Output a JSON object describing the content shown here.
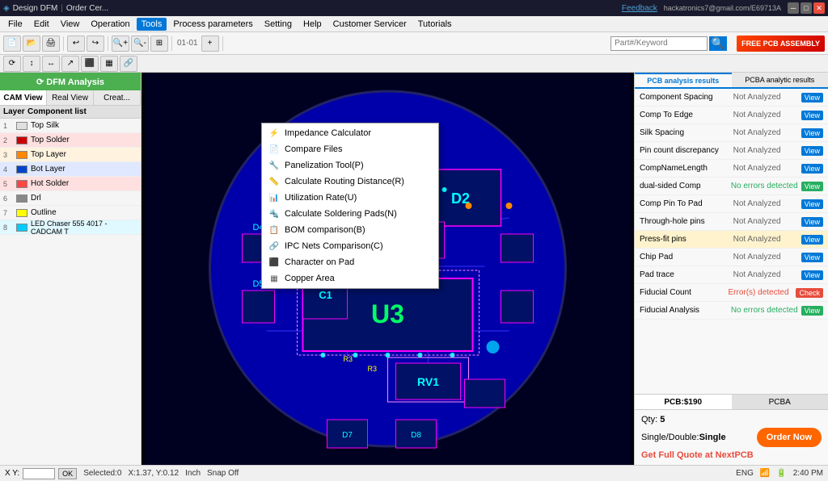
{
  "titlebar": {
    "title1": "Design DFM",
    "title2": "Order Cer...",
    "feedback": "Feedback",
    "user": "hackatronics7@gmail.com/E69713A",
    "controls": [
      "—",
      "□",
      "×"
    ]
  },
  "menubar": {
    "items": [
      "File",
      "Edit",
      "View",
      "Operation",
      "Tools",
      "Process parameters",
      "Setting",
      "Help",
      "Customer Servicer",
      "Tutorials"
    ]
  },
  "toolbar": {
    "part_placeholder": "Part#/Keyword",
    "pcb_assembly": "FREE  PCB ASSEMBLY"
  },
  "dfm": {
    "btn_label": "⟳ DFM Analysis"
  },
  "view_tabs": [
    "CAM View",
    "Real View",
    "Creat..."
  ],
  "layer_header": {
    "layer_col": "Layer",
    "component_col": "Component list"
  },
  "layers": [
    {
      "num": "1",
      "color": "#e0e0e0",
      "name": "Top Silk"
    },
    {
      "num": "2",
      "color": "#cc0000",
      "name": "Top Solder"
    },
    {
      "num": "3",
      "color": "#ff8800",
      "name": "Top Layer"
    },
    {
      "num": "4",
      "color": "#0044cc",
      "name": "Bot Layer"
    },
    {
      "num": "5",
      "color": "#ff4444",
      "name": "Hot Solder"
    },
    {
      "num": "6",
      "color": "#888888",
      "name": "Drl"
    },
    {
      "num": "7",
      "color": "#ffff00",
      "name": "Outline"
    },
    {
      "num": "8",
      "color": "#00ccff",
      "name": "LED Chaser 555 4017 - CADCAM T"
    }
  ],
  "tools_menu": {
    "items": [
      {
        "icon": "⚡",
        "label": "Impedance Calculator"
      },
      {
        "icon": "📄",
        "label": "Compare Files"
      },
      {
        "icon": "🔧",
        "label": "Panelization Tool(P)"
      },
      {
        "icon": "📏",
        "label": "Calculate Routing Distance(R)"
      },
      {
        "icon": "📊",
        "label": "Utilization Rate(U)"
      },
      {
        "icon": "🔩",
        "label": "Calculate Soldering Pads(N)"
      },
      {
        "icon": "📋",
        "label": "BOM comparison(B)"
      },
      {
        "icon": "🔗",
        "label": "IPC Nets Comparison(C)"
      },
      {
        "icon": "⬛",
        "label": "Character on Pad"
      },
      {
        "icon": "▦",
        "label": "Copper Area"
      }
    ]
  },
  "analysis": {
    "tabs": [
      "PCB analysis results",
      "PCBA analytic results"
    ],
    "rows": [
      {
        "name": "Component Spacing",
        "status": "Not Analyzed",
        "btn": "View",
        "btn_type": "normal",
        "highlight": false
      },
      {
        "name": "Comp To Edge",
        "status": "Not Analyzed",
        "btn": "View",
        "btn_type": "normal",
        "highlight": false
      },
      {
        "name": "Silk Spacing",
        "status": "Not Analyzed",
        "btn": "View",
        "btn_type": "normal",
        "highlight": false
      },
      {
        "name": "Pin count discrepancy",
        "status": "Not Analyzed",
        "btn": "View",
        "btn_type": "normal",
        "highlight": false
      },
      {
        "name": "CompNameLength",
        "status": "Not Analyzed",
        "btn": "View",
        "btn_type": "normal",
        "highlight": false
      },
      {
        "name": "dual-sided Comp",
        "status": "No errors detected",
        "btn": "View",
        "btn_type": "green",
        "highlight": false
      },
      {
        "name": "Comp Pin To Pad",
        "status": "Not Analyzed",
        "btn": "View",
        "btn_type": "normal",
        "highlight": false
      },
      {
        "name": "Through-hole pins",
        "status": "Not Analyzed",
        "btn": "View",
        "btn_type": "normal",
        "highlight": false
      },
      {
        "name": "Press-fit pins",
        "status": "Not Analyzed",
        "btn": "View",
        "btn_type": "normal",
        "highlight": true
      },
      {
        "name": "Chip Pad",
        "status": "Not Analyzed",
        "btn": "View",
        "btn_type": "normal",
        "highlight": false
      },
      {
        "name": "Pad trace",
        "status": "Not Analyzed",
        "btn": "View",
        "btn_type": "normal",
        "highlight": false
      },
      {
        "name": "Fiducial Count",
        "status": "Error(s) detected",
        "btn": "Check",
        "btn_type": "red",
        "highlight": false
      },
      {
        "name": "Fiducial Analysis",
        "status": "No errors detected",
        "btn": "View",
        "btn_type": "green",
        "highlight": false
      }
    ]
  },
  "pcb_bottom": {
    "tabs": [
      "PCB:$190",
      "PCBA"
    ],
    "qty_label": "Qty:",
    "qty_value": "5",
    "sides_label": "Single/Double:",
    "sides_value": "Single",
    "order_btn": "Order Now",
    "quote_text": "Get Full Quote at NextPCB"
  },
  "statusbar": {
    "xy_label": "X Y:",
    "ok_btn": "OK",
    "selected": "Selected:0",
    "coords": "X:1.37, Y:0.12",
    "unit": "Inch",
    "snap": "Snap Off"
  },
  "systray": {
    "lang": "ENG",
    "time": "2:40 PM"
  }
}
